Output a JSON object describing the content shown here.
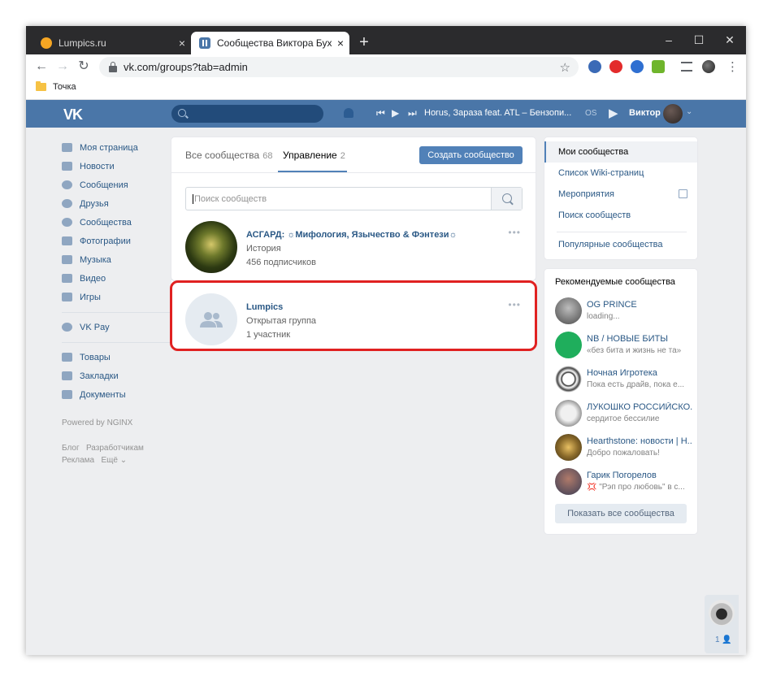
{
  "browser": {
    "tabs": [
      {
        "title": "Lumpics.ru",
        "close": "×"
      },
      {
        "title": "Сообщества Виктора Бухтеева",
        "close": "×"
      }
    ],
    "new_tab": "+",
    "window_controls": {
      "minimize": "–",
      "maximize": "☐",
      "close": "✕"
    },
    "url": "vk.com/groups?tab=admin",
    "bookmark": "Точка"
  },
  "vk_header": {
    "logo": "VK",
    "track": "Horus, Зараза feat. ATL – Бензопи...",
    "os_label": "OS",
    "user_name": "Виктор"
  },
  "left_nav": {
    "items": [
      {
        "label": "Моя страница",
        "icon": "home-icon"
      },
      {
        "label": "Новости",
        "icon": "news-icon"
      },
      {
        "label": "Сообщения",
        "icon": "messages-icon"
      },
      {
        "label": "Друзья",
        "icon": "friends-icon"
      },
      {
        "label": "Сообщества",
        "icon": "groups-icon"
      },
      {
        "label": "Фотографии",
        "icon": "photo-icon"
      },
      {
        "label": "Музыка",
        "icon": "music-icon"
      },
      {
        "label": "Видео",
        "icon": "video-icon"
      },
      {
        "label": "Игры",
        "icon": "games-icon"
      }
    ],
    "pay": {
      "label": "VK Pay",
      "icon": "vkpay-icon"
    },
    "items2": [
      {
        "label": "Товары",
        "icon": "goods-icon"
      },
      {
        "label": "Закладки",
        "icon": "bookmarks-icon"
      },
      {
        "label": "Документы",
        "icon": "documents-icon"
      }
    ],
    "powered": "Powered by NGINX",
    "footer": {
      "blog": "Блог",
      "dev": "Разработчикам",
      "ads": "Реклама",
      "more": "Ещё ⌄"
    }
  },
  "main": {
    "tabs": [
      {
        "label": "Все сообщества",
        "count": "68"
      },
      {
        "label": "Управление",
        "count": "2"
      }
    ],
    "create_button": "Создать сообщество",
    "search_placeholder": "Поиск сообществ",
    "groups": [
      {
        "name": "АСГАРД: ☼Мифология, Язычество & Фэнтези☼",
        "type": "История",
        "members": "456 подписчиков",
        "menu": "•••"
      },
      {
        "name": "Lumpics",
        "type": "Открытая группа",
        "members": "1 участник",
        "menu": "•••"
      }
    ]
  },
  "right_menu": {
    "items": [
      "Мои сообщества",
      "Список Wiki-страниц",
      "Мероприятия",
      "Поиск сообществ",
      "Популярные сообщества"
    ]
  },
  "recommended": {
    "title": "Рекомендуемые сообщества",
    "items": [
      {
        "name": "OG PRINCE",
        "desc": "loading..."
      },
      {
        "name": "NB / НОВЫЕ БИТЫ",
        "desc": "«без бита и жизнь не та»"
      },
      {
        "name": "Ночная Игротека",
        "desc": "Пока есть драйв, пока е..."
      },
      {
        "name": "ЛУКОШКО РОССИЙСКО...",
        "desc": "сердитое бессилие"
      },
      {
        "name": "Hearthstone: новости | H...",
        "desc": "Добро пожаловать!"
      },
      {
        "name": "Гарик Погорелов",
        "desc": "💢 \"Рэп про любовь\" в с..."
      }
    ],
    "show_all": "Показать все сообщества"
  },
  "chat": {
    "count": "1"
  }
}
